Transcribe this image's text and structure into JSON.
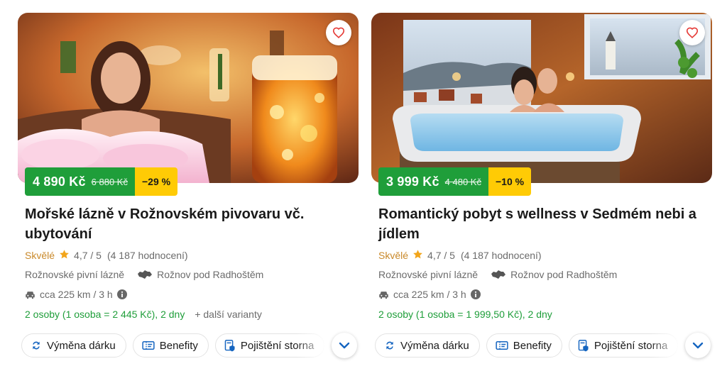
{
  "cards": [
    {
      "price_now": "4 890 Kč",
      "price_old": "6 880 Kč",
      "discount": "−29 %",
      "title": "Mořské lázně v Rožnovském pivovaru vč. ubytování",
      "rating_word": "Skvělé",
      "rating_score": "4,7 / 5",
      "rating_count": "(4 187 hodnocení)",
      "venue": "Rožnovské pivní lázně",
      "city": "Rožnov pod Radhoštěm",
      "distance": "cca 225 km / 3 h",
      "stay": "2 osoby (1 osoba = 2 445 Kč), 2 dny",
      "variants": "+ další varianty",
      "chips": [
        "Výměna dárku",
        "Benefity",
        "Pojištění storna"
      ]
    },
    {
      "price_now": "3 999 Kč",
      "price_old": "4 480 Kč",
      "discount": "−10 %",
      "title": "Romantický pobyt s wellness v Sedmém nebi a jídlem",
      "rating_word": "Skvělé",
      "rating_score": "4,7 / 5",
      "rating_count": "(4 187 hodnocení)",
      "venue": "Rožnovské pivní lázně",
      "city": "Rožnov pod Radhoštěm",
      "distance": "cca 225 km / 3 h",
      "stay": "2 osoby (1 osoba = 1 999,50 Kč), 2 dny",
      "chips": [
        "Výměna dárku",
        "Benefity",
        "Pojištění storna"
      ]
    }
  ],
  "icons": {
    "favorite": "heart-icon",
    "rating": "star-icon",
    "region": "czech-map-icon",
    "distance": "car-icon",
    "info": "info-icon",
    "exchange": "exchange-icon",
    "benefits": "ticket-icon",
    "insurance": "insurance-icon",
    "expand": "chevron-down-icon"
  },
  "colors": {
    "price_green": "#1f9e3a",
    "discount_yellow": "#ffcb05",
    "rating_gold": "#c9892a",
    "accent_blue": "#1565c0",
    "favorite_red": "#e53935"
  }
}
